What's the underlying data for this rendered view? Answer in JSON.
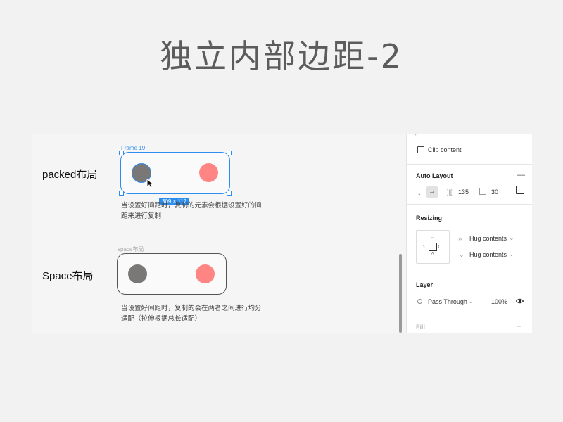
{
  "slide": {
    "title": "独立内部边距-2"
  },
  "canvas": {
    "row1": {
      "label": "packed布局",
      "frame_label": "Frame 19",
      "size_badge": "309 × 117",
      "description_line1": "当设置好间距时，复制的元素会根据设置好的间",
      "description_line2": "距来进行复制"
    },
    "row2": {
      "label": "Space布局",
      "frame_label": "space布局",
      "description_line1": "当设置好间距时，复制的会在两者之间进行均分",
      "description_line2": "适配（拉伸根据总长适配）"
    },
    "colors": {
      "gray_dot": "#7a7777",
      "red_dot": "#ff8585",
      "selection": "#2b8df0"
    }
  },
  "panel": {
    "clip_content": "Clip content",
    "auto_layout": {
      "title": "Auto Layout",
      "collapse": "—",
      "direction_down": "↓",
      "direction_right": "→",
      "spacing_icon": "]|[",
      "spacing_value": "135",
      "padding_value": "30"
    },
    "resizing": {
      "title": "Resizing",
      "horizontal": "Hug contents",
      "vertical": "Hug contents"
    },
    "layer": {
      "title": "Layer",
      "blend_mode": "Pass Through",
      "opacity": "100%"
    },
    "fill": {
      "title": "Fill",
      "add": "+"
    }
  }
}
